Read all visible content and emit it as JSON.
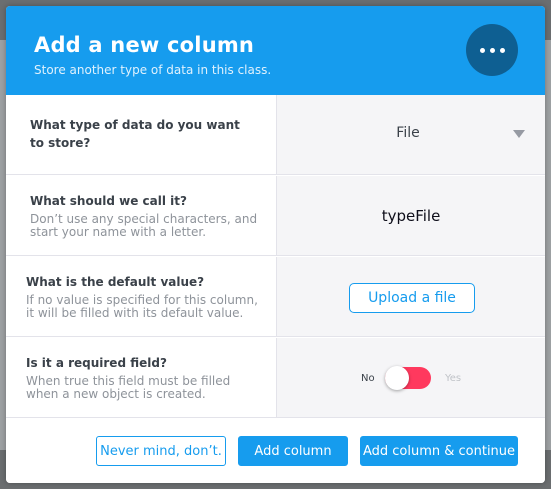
{
  "modal": {
    "title": "Add a new column",
    "subtitle": "Store another type of data in this class.",
    "menu_icon": "more-horizontal-icon"
  },
  "rows": {
    "type": {
      "title": "What type of data do you want to store?",
      "selected": "File"
    },
    "name": {
      "title": "What should we call it?",
      "description": "Don’t use any special characters, and start your name with a letter.",
      "value": "typeFile"
    },
    "default": {
      "title": "What is the default value?",
      "description": "If no value is specified for this column, it will be filled with its default value.",
      "button_label": "Upload a file"
    },
    "required": {
      "title": "Is it a required field?",
      "description": "When true this field must be filled when a new object is created.",
      "no_label": "No",
      "yes_label": "Yes",
      "toggle_state": "No"
    }
  },
  "footer": {
    "cancel_label": "Never mind, don’t.",
    "add_label": "Add column",
    "add_continue_label": "Add column & continue"
  },
  "colors": {
    "accent": "#169cee",
    "header_icon_bg": "#0e5f92",
    "toggle_off": "#ff395e"
  }
}
